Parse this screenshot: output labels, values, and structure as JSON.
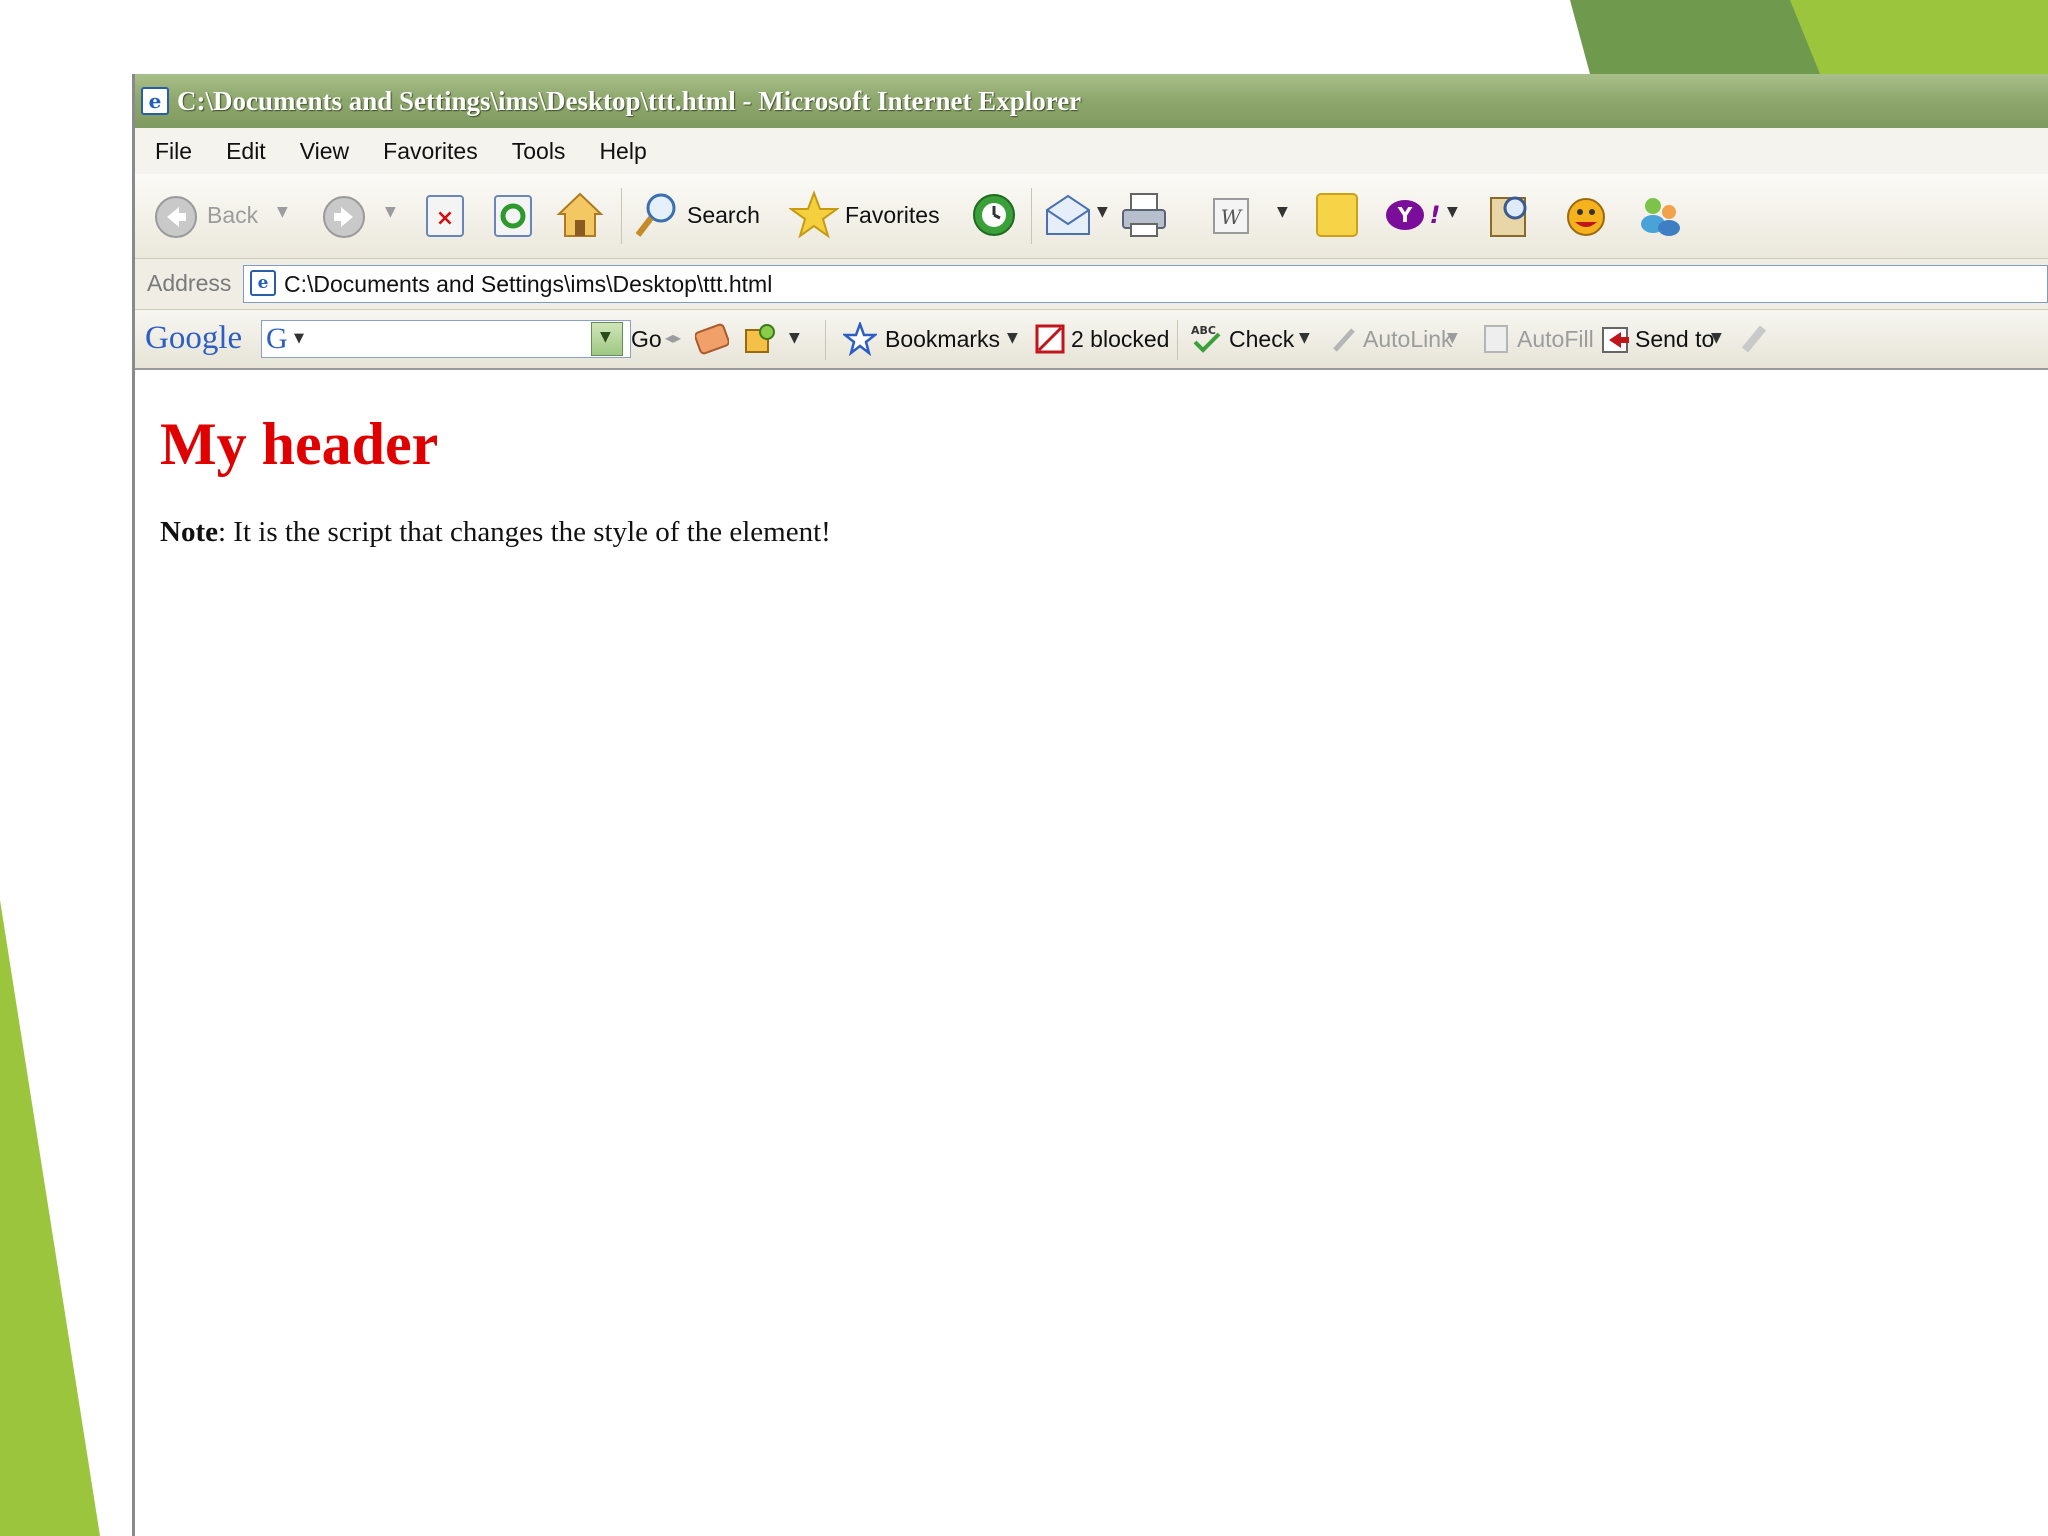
{
  "window": {
    "title": "C:\\Documents and Settings\\ims\\Desktop\\ttt.html - Microsoft Internet Explorer"
  },
  "menu": [
    "File",
    "Edit",
    "View",
    "Favorites",
    "Tools",
    "Help"
  ],
  "toolbar": {
    "back_label": "Back",
    "search_label": "Search",
    "favorites_label": "Favorites"
  },
  "address": {
    "label": "Address",
    "value": "C:\\Documents and Settings\\ims\\Desktop\\ttt.html"
  },
  "google_bar": {
    "logo": "Google",
    "go_label": "Go",
    "bookmarks_label": "Bookmarks",
    "blocked_label": "2 blocked",
    "check_label": "Check",
    "autolink_label": "AutoLink",
    "autofill_label": "AutoFill",
    "sendto_label": "Send to"
  },
  "page": {
    "header": "My header",
    "note_bold": "Note",
    "note_text": ": It is the script that changes the style of the element!",
    "header_color": "#e00000"
  },
  "colors": {
    "slide_accent": "#9bc53d",
    "slide_accent_dark": "#6f9a4e",
    "titlebar": "#8fa86e"
  }
}
